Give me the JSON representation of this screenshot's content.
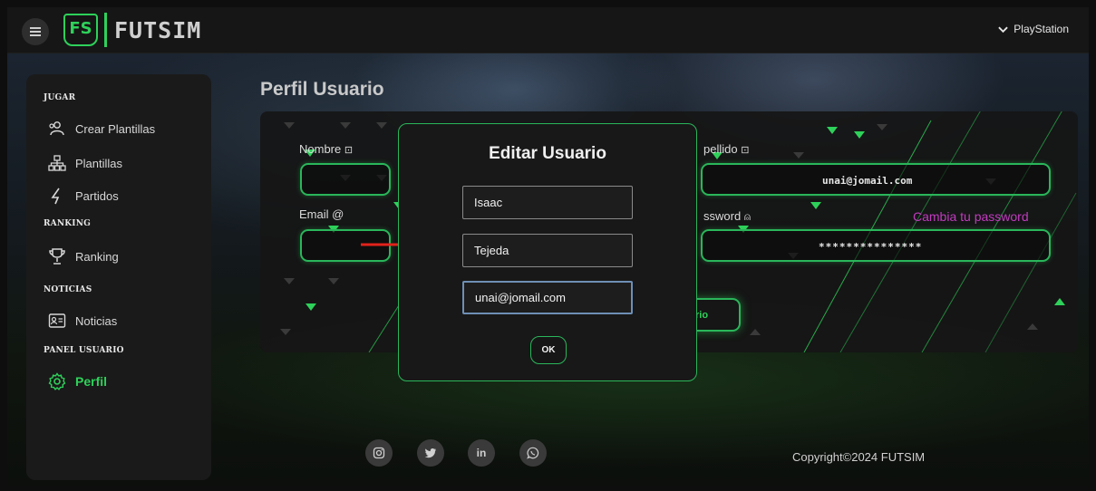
{
  "app": {
    "logo_badge": "FS",
    "title": "FUTSIM"
  },
  "platform": {
    "label": "PlayStation",
    "icon": "chevron-down-icon"
  },
  "sidebar": {
    "sections": [
      {
        "title": "JUGAR",
        "items": [
          {
            "label": "Crear Plantillas",
            "icon": "users-add-icon"
          },
          {
            "label": "Plantillas",
            "icon": "hierarchy-icon"
          },
          {
            "label": "Partidos",
            "icon": "lightning-icon"
          }
        ]
      },
      {
        "title": "RANKING",
        "items": [
          {
            "label": "Ranking",
            "icon": "trophy-icon"
          }
        ]
      },
      {
        "title": "NOTICIAS",
        "items": [
          {
            "label": "Noticias",
            "icon": "id-card-icon"
          }
        ]
      },
      {
        "title": "PANEL USUARIO",
        "items": [
          {
            "label": "Perfil",
            "icon": "gear-icon",
            "active": true
          }
        ]
      }
    ]
  },
  "page": {
    "title": "Perfil Usuario"
  },
  "profile_form": {
    "nombre_label": "Nombre",
    "apellido_label": "pellido",
    "email_label": "Email @",
    "password_label": "ssword",
    "email_value": "unai@jomail.com",
    "password_value": "***************",
    "change_password_link": "Cambia tu password",
    "save_button_fragment": "rio"
  },
  "modal": {
    "title": "Editar Usuario",
    "first_name": "Isaac",
    "last_name": "Tejeda",
    "email": "unai@jomail.com",
    "ok_label": "OK"
  },
  "footer": {
    "social": [
      "instagram-icon",
      "twitter-icon",
      "linkedin-icon",
      "whatsapp-icon"
    ],
    "linkedin_text": "in",
    "copyright": "Copyright©2024 FUTSIM"
  },
  "colors": {
    "accent": "#2ed15a",
    "link": "#c13bbf",
    "panel": "#1a1a1a",
    "page_bg": "#0f1211"
  }
}
